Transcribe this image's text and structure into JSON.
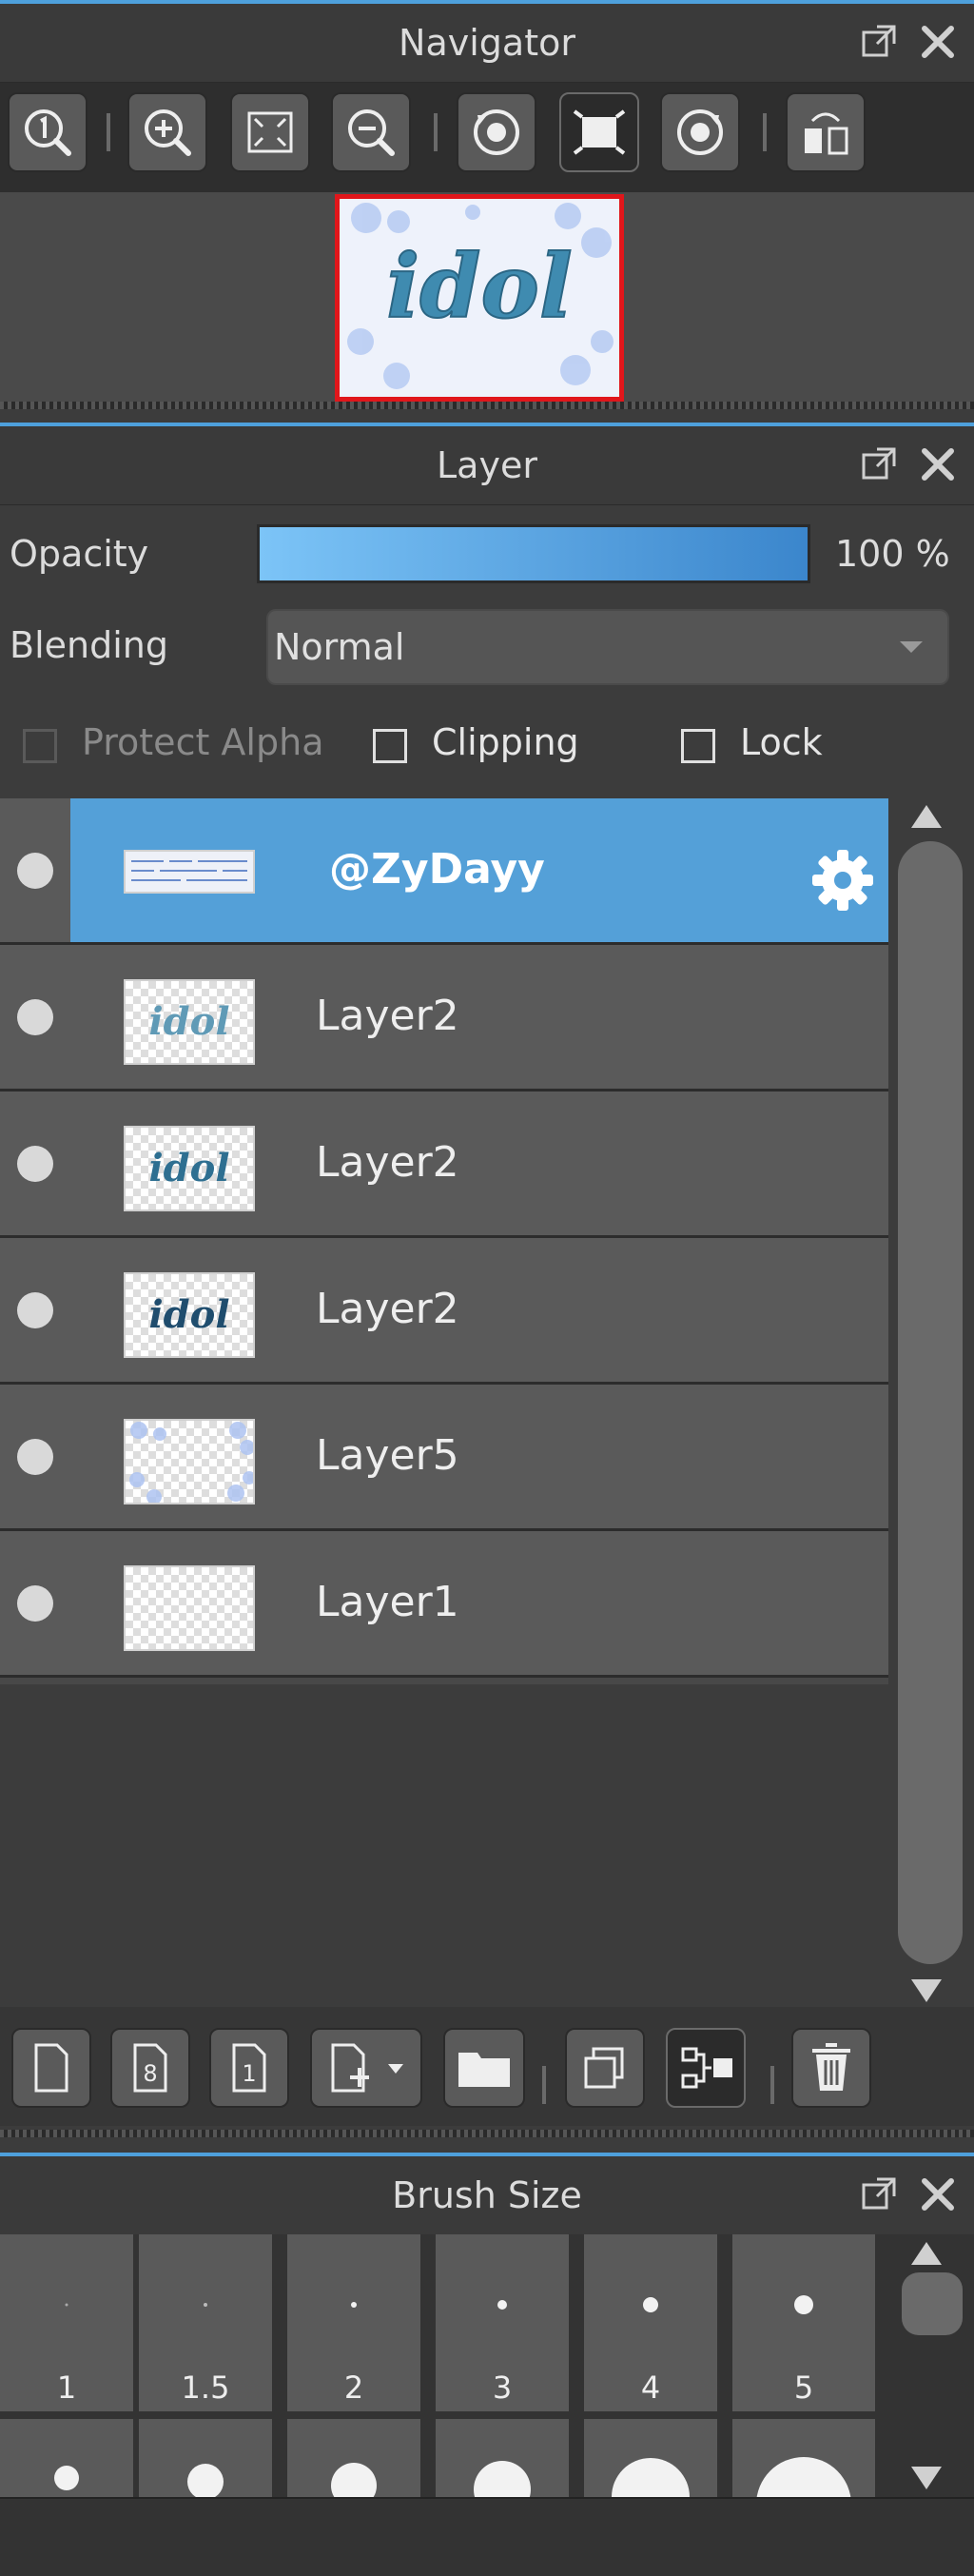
{
  "navigator": {
    "title": "Navigator",
    "thumbnail_text": "idol",
    "toolbar": [
      {
        "icon": "zoom-actual-icon"
      },
      {
        "icon": "zoom-in-icon"
      },
      {
        "icon": "fit-screen-icon"
      },
      {
        "icon": "zoom-out-icon"
      },
      {
        "icon": "rotate-left-icon"
      },
      {
        "icon": "reset-view-icon"
      },
      {
        "icon": "rotate-right-icon"
      },
      {
        "icon": "flip-horizontal-icon"
      }
    ]
  },
  "layer_panel": {
    "title": "Layer",
    "opacity_label": "Opacity",
    "opacity_value": "100 %",
    "opacity": 1.0,
    "blending_label": "Blending",
    "blending_value": "Normal",
    "protect_alpha_label": "Protect Alpha",
    "clipping_label": "Clipping",
    "lock_label": "Lock",
    "layers": [
      {
        "name": "@ZyDayy",
        "selected": true,
        "thumb_text": ""
      },
      {
        "name": "Layer2",
        "selected": false,
        "thumb_text": "idol"
      },
      {
        "name": "Layer2",
        "selected": false,
        "thumb_text": "idol"
      },
      {
        "name": "Layer2",
        "selected": false,
        "thumb_text": "idol"
      },
      {
        "name": "Layer5",
        "selected": false,
        "thumb_text": ""
      },
      {
        "name": "Layer1",
        "selected": false,
        "thumb_text": ""
      }
    ],
    "toolbar": [
      {
        "icon": "new-layer-icon"
      },
      {
        "icon": "new-8bit-layer-icon"
      },
      {
        "icon": "new-1bit-layer-icon"
      },
      {
        "icon": "add-layer-menu-icon"
      },
      {
        "icon": "new-folder-icon"
      },
      {
        "icon": "duplicate-layer-icon"
      },
      {
        "icon": "merge-layer-icon"
      },
      {
        "icon": "delete-layer-icon"
      }
    ]
  },
  "brush_size": {
    "title": "Brush Size",
    "sizes": [
      "1",
      "1.5",
      "2",
      "3",
      "4",
      "5"
    ]
  },
  "colors": {
    "accent": "#4ea0dc",
    "selected_row": "#54a0d8",
    "panel": "#3c3c3c",
    "close_icon": "#d0d0d0"
  }
}
